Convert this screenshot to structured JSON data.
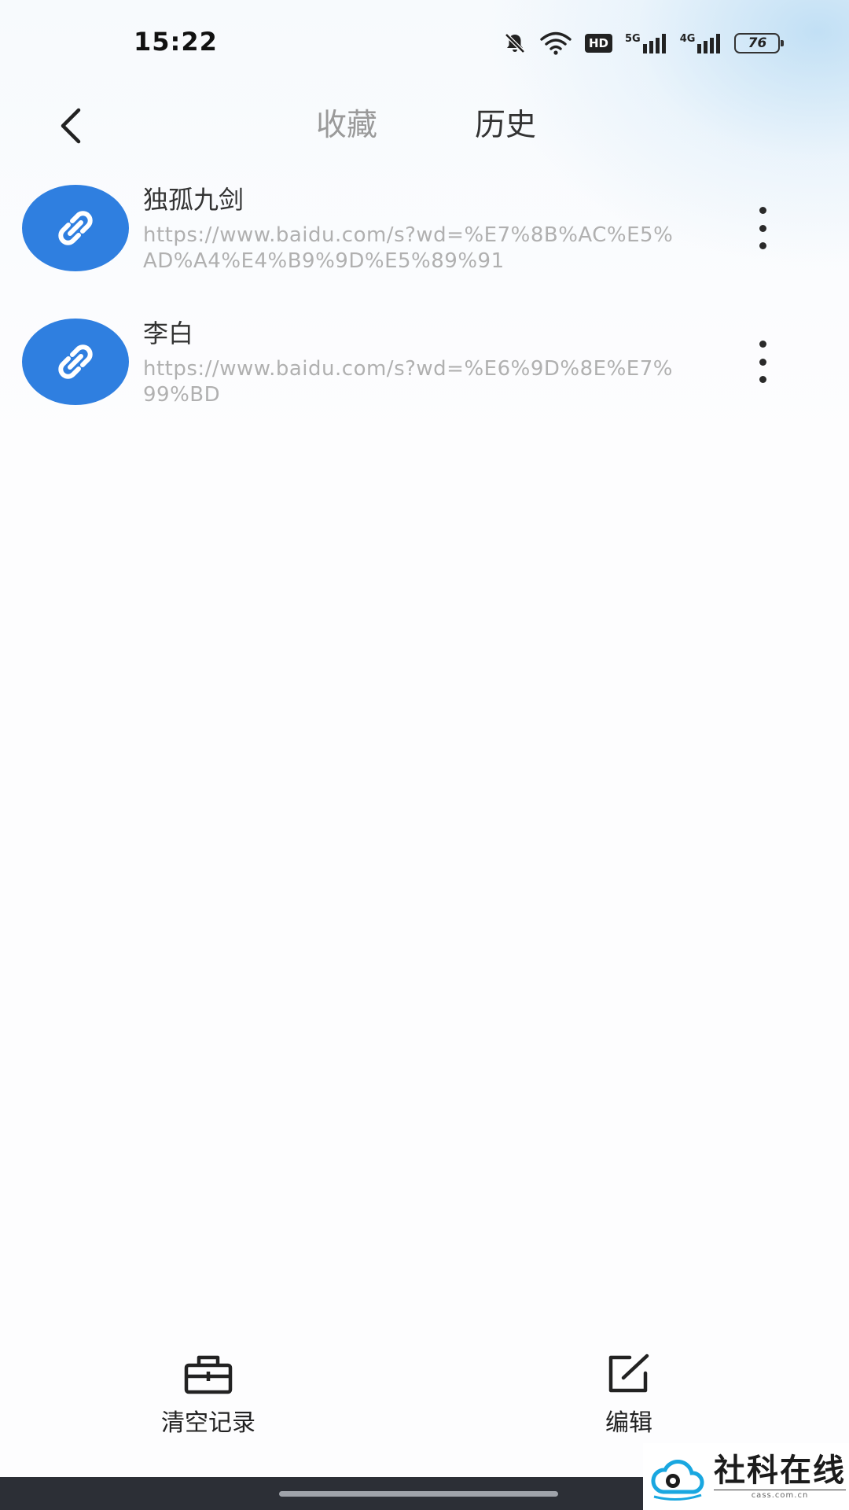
{
  "status_bar": {
    "time": "15:22",
    "icons": [
      "bell-off-icon",
      "wifi-icon",
      "hd-badge",
      "signal-5g-icon",
      "signal-4g-icon",
      "battery-icon"
    ],
    "hd_label": "HD",
    "net_5g": "5G",
    "net_4g": "4G",
    "battery_level": "76"
  },
  "header": {
    "tabs": [
      {
        "label": "收藏",
        "active": false
      },
      {
        "label": "历史",
        "active": true
      }
    ]
  },
  "history": {
    "items": [
      {
        "title": "独孤九剑",
        "url": "https://www.baidu.com/s?wd=%E7%8B%AC%E5%AD%A4%E4%B9%9D%E5%89%91",
        "icon": "link-icon"
      },
      {
        "title": "李白",
        "url": "https://www.baidu.com/s?wd=%E6%9D%8E%E7%99%BD",
        "icon": "link-icon"
      }
    ]
  },
  "toolbar": {
    "clear_label": "清空记录",
    "edit_label": "编辑"
  },
  "watermark": {
    "name": "社科在线",
    "domain": "cass.com.cn"
  },
  "colors": {
    "accent": "#2f7fe0",
    "tab_inactive": "#9a9a9a",
    "tab_active": "#333333",
    "url_text": "#b0b0b0",
    "nav_bar": "#2c2f36"
  }
}
